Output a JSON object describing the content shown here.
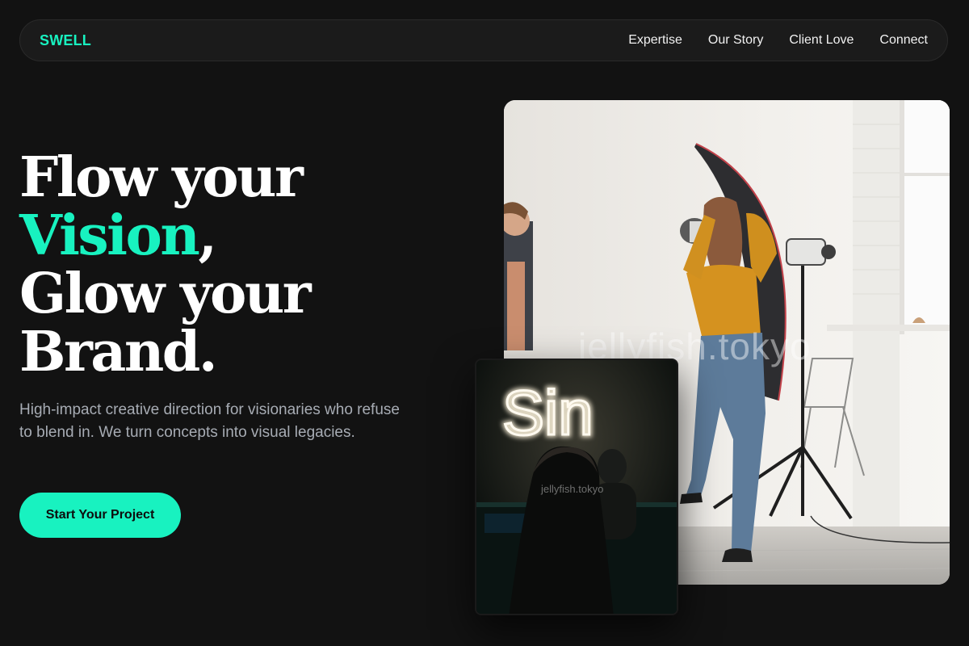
{
  "brand": {
    "logo": "SWELL",
    "accent_color": "#18f2c0",
    "background_color": "#121212"
  },
  "nav": {
    "links": [
      {
        "label": "Expertise"
      },
      {
        "label": "Our Story"
      },
      {
        "label": "Client Love"
      },
      {
        "label": "Connect"
      }
    ]
  },
  "hero": {
    "title_line1": "Flow your",
    "title_accent": "Vision",
    "title_comma": ",",
    "title_line3": "Glow your",
    "title_line4": "Brand.",
    "description": "High-impact creative direction for visionaries who refuse to blend in. We turn concepts into visual legacies.",
    "cta_label": "Start Your Project"
  },
  "images": {
    "main_watermark": "jellyfish.tokyo",
    "inset_watermark": "jellyfish.tokyo",
    "inset_neon_text": "Sin"
  }
}
